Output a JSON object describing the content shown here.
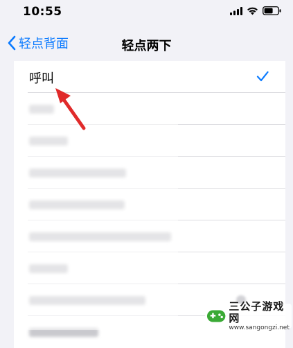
{
  "status": {
    "time": "10:55"
  },
  "nav": {
    "back_label": "轻点背面",
    "title": "轻点两下"
  },
  "list": {
    "selected_label": "呼叫",
    "blurred_rows": 8
  },
  "colors": {
    "accent": "#0a7aff",
    "arrow": "#e02a2a"
  },
  "watermark": {
    "title": "三公子游戏网",
    "url": "www.sangongzi.net"
  }
}
